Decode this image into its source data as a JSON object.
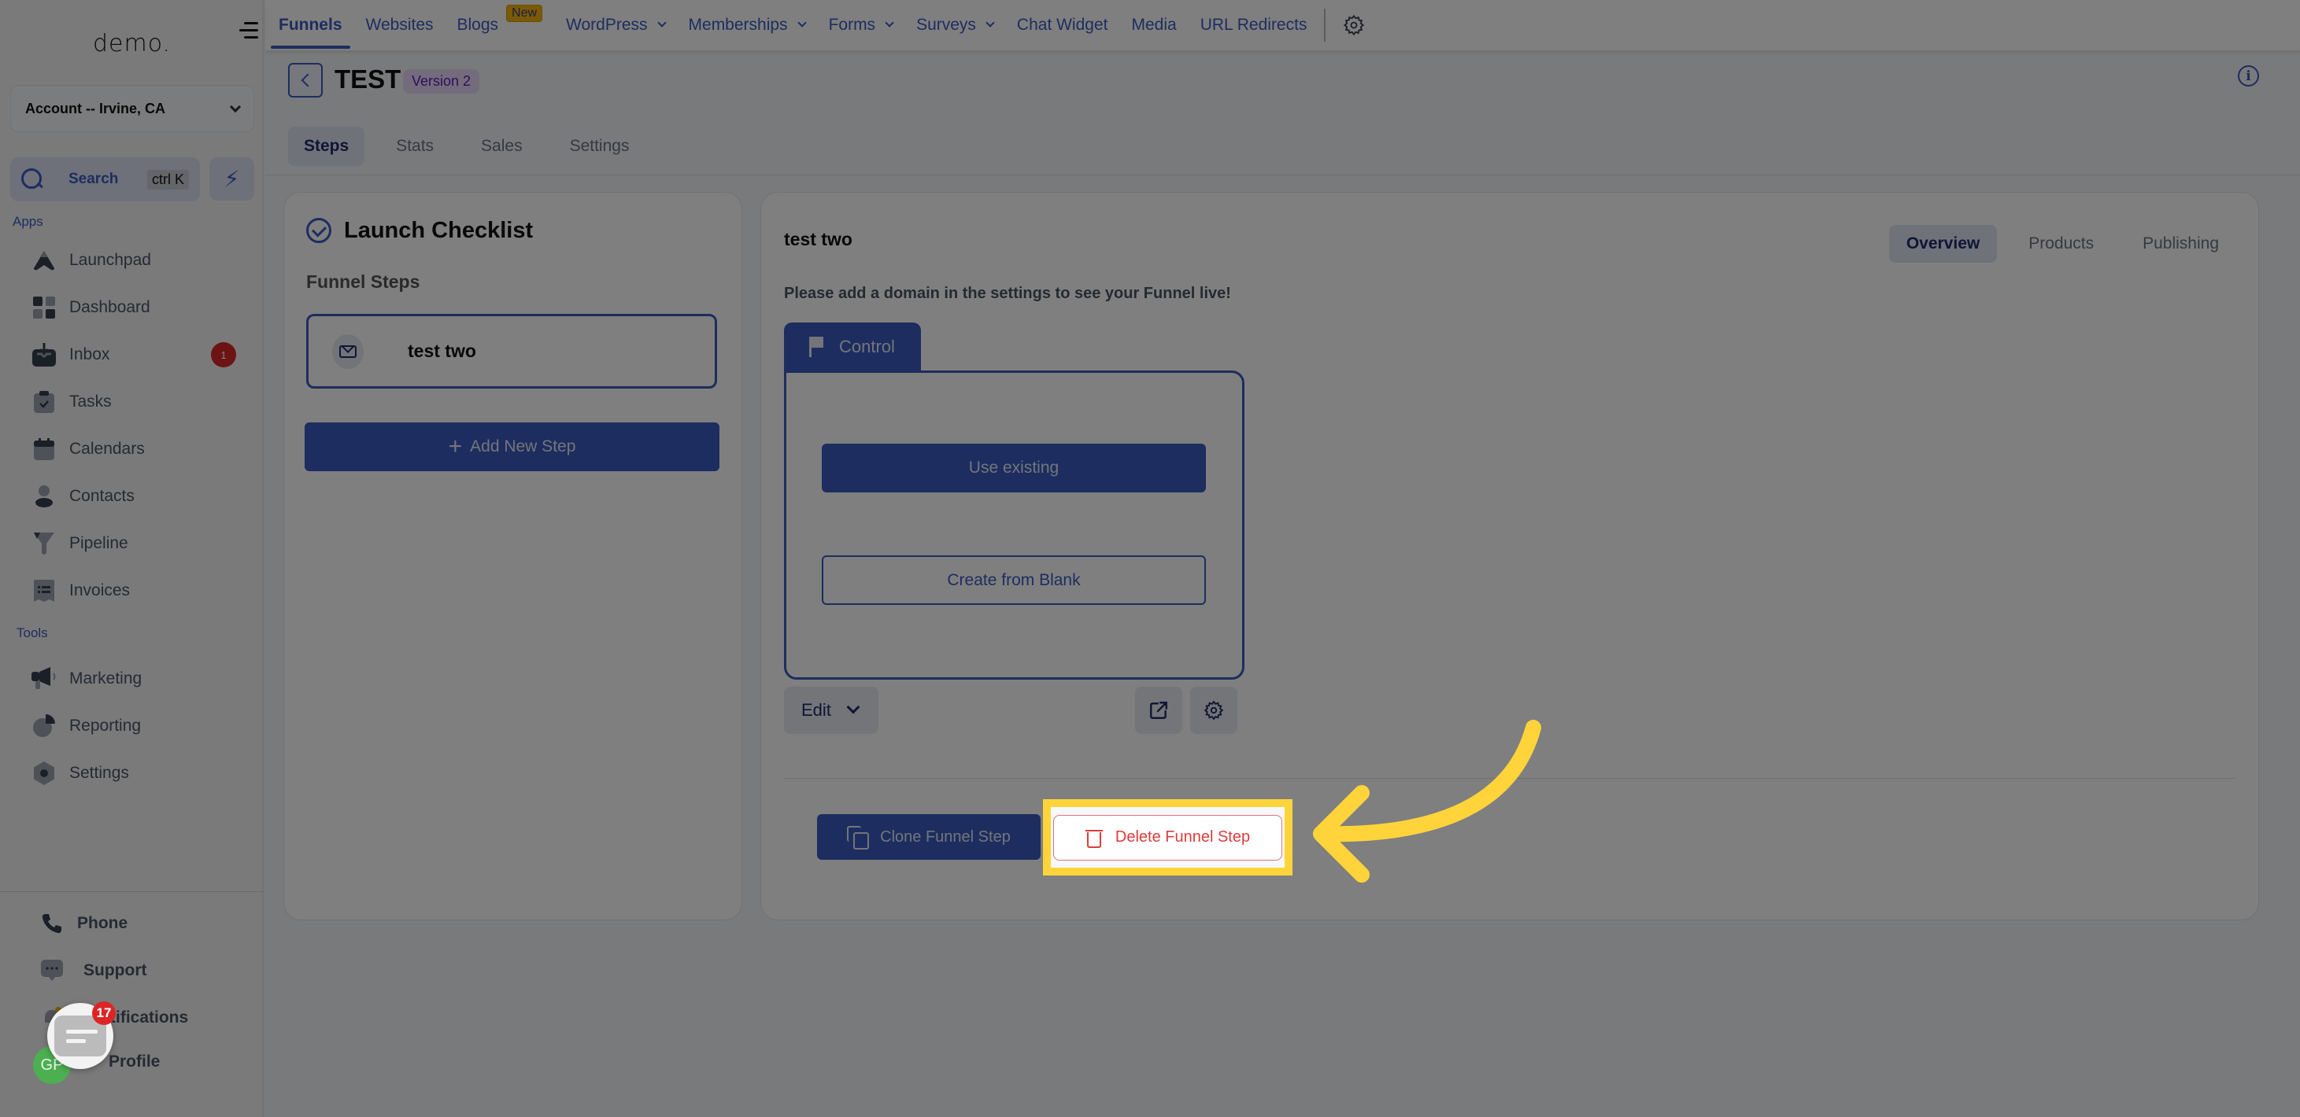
{
  "sidebar": {
    "logo": "demo.",
    "account": "Account -- Irvine, CA",
    "search_label": "Search",
    "search_shortcut": "ctrl K",
    "apps_label": "Apps",
    "tools_label": "Tools",
    "apps": [
      {
        "label": "Launchpad",
        "icon": "launchpad-icon"
      },
      {
        "label": "Dashboard",
        "icon": "dashboard-icon"
      },
      {
        "label": "Inbox",
        "icon": "inbox-icon",
        "badge": "1"
      },
      {
        "label": "Tasks",
        "icon": "tasks-icon"
      },
      {
        "label": "Calendars",
        "icon": "calendar-icon"
      },
      {
        "label": "Contacts",
        "icon": "contacts-icon"
      },
      {
        "label": "Pipeline",
        "icon": "pipeline-icon"
      },
      {
        "label": "Invoices",
        "icon": "invoices-icon"
      }
    ],
    "tools": [
      {
        "label": "Marketing",
        "icon": "megaphone-icon"
      },
      {
        "label": "Reporting",
        "icon": "pie-chart-icon"
      },
      {
        "label": "Settings",
        "icon": "settings-icon"
      }
    ],
    "bottom": [
      {
        "label": "Phone",
        "icon": "phone-icon"
      },
      {
        "label": "Support",
        "icon": "support-icon"
      },
      {
        "label": "Notifications",
        "icon": "bell-icon"
      },
      {
        "label": "Profile",
        "icon": "avatar"
      }
    ],
    "avatar_initials": "GP",
    "chat_badge": "17"
  },
  "topnav": {
    "items": [
      {
        "label": "Funnels",
        "active": true
      },
      {
        "label": "Websites"
      },
      {
        "label": "Blogs",
        "badge": "New"
      },
      {
        "label": "WordPress",
        "dropdown": true
      },
      {
        "label": "Memberships",
        "dropdown": true
      },
      {
        "label": "Forms",
        "dropdown": true
      },
      {
        "label": "Surveys",
        "dropdown": true
      },
      {
        "label": "Chat Widget"
      },
      {
        "label": "Media"
      },
      {
        "label": "URL Redirects"
      }
    ]
  },
  "header": {
    "title": "TEST",
    "version": "Version 2",
    "tabs": [
      "Steps",
      "Stats",
      "Sales",
      "Settings"
    ],
    "active_tab": "Steps"
  },
  "left_card": {
    "title": "Launch Checklist",
    "subtitle": "Funnel Steps",
    "steps": [
      {
        "name": "test two",
        "icon": "mail-icon"
      }
    ],
    "add_step": "Add New Step"
  },
  "right_card": {
    "title": "test two",
    "tabs": [
      "Overview",
      "Products",
      "Publishing"
    ],
    "active_tab": "Overview",
    "note": "Please add a domain in the settings to see your Funnel live!",
    "variant_tab": "Control",
    "use_existing": "Use existing",
    "create_blank": "Create from Blank",
    "edit": "Edit",
    "clone": "Clone Funnel Step",
    "delete": "Delete Funnel Step"
  },
  "colors": {
    "accent": "#3b5bbf",
    "danger": "#dc3c3c",
    "highlight": "#ffd43b"
  }
}
